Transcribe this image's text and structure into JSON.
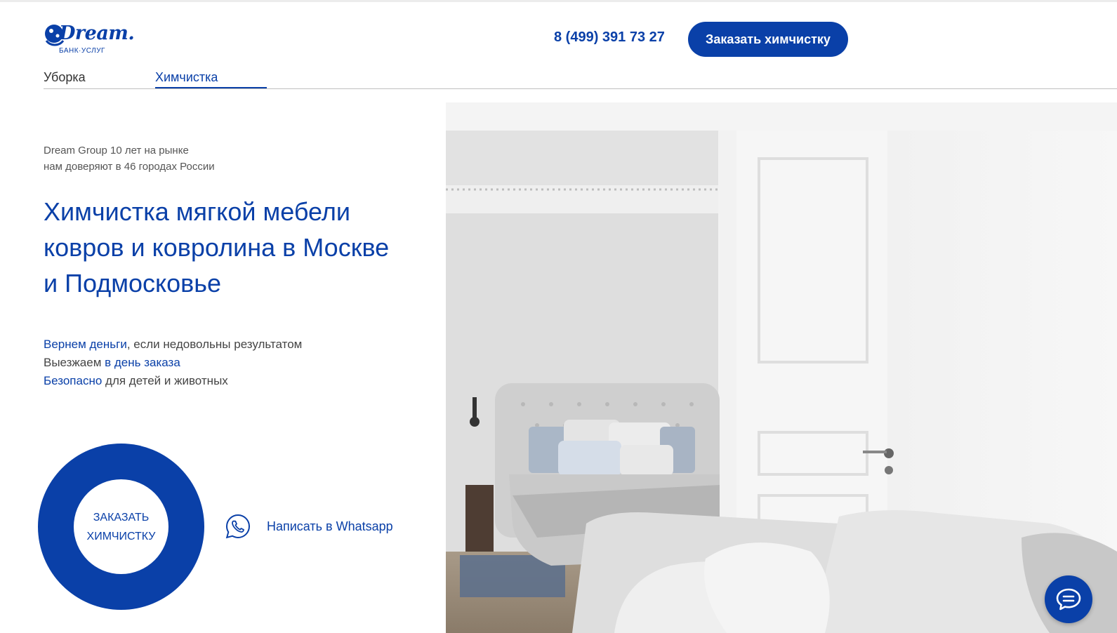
{
  "header": {
    "logo_word": "Dream.",
    "logo_sub": "БАНК·УСЛУГ",
    "phone": "8 (499) 391 73 27",
    "cta": "Заказать химчистку"
  },
  "nav": {
    "tabs": [
      {
        "label": "Уборка",
        "active": false
      },
      {
        "label": "Химчистка",
        "active": true
      }
    ]
  },
  "intro": {
    "line1": "Dream Group 10 лет на рынке",
    "line2": "нам доверяют в 46 городах России"
  },
  "headline": {
    "line1": "Химчистка мягкой мебели",
    "line2": "ковров и ковролина в Москве",
    "line3": "и Подмосковье"
  },
  "benefits": [
    {
      "highlight": "Вернем деньги",
      "rest": ", если недовольны результатом",
      "highlight_first": true
    },
    {
      "highlight": "в день заказа",
      "rest": "Выезжаем ",
      "highlight_first": false
    },
    {
      "highlight": "Безопасно",
      "rest": " для детей и животных",
      "highlight_first": true
    }
  ],
  "order_ring": {
    "line1": "ЗАКАЗАТЬ",
    "line2": "ХИМЧИСТКУ"
  },
  "whatsapp": {
    "label": "Написать в Whatsapp",
    "icon": "whatsapp-icon"
  },
  "chat": {
    "icon": "chat-bubble-icon"
  },
  "colors": {
    "brand": "#0a40a8",
    "text": "#333333",
    "muted": "#555555"
  }
}
